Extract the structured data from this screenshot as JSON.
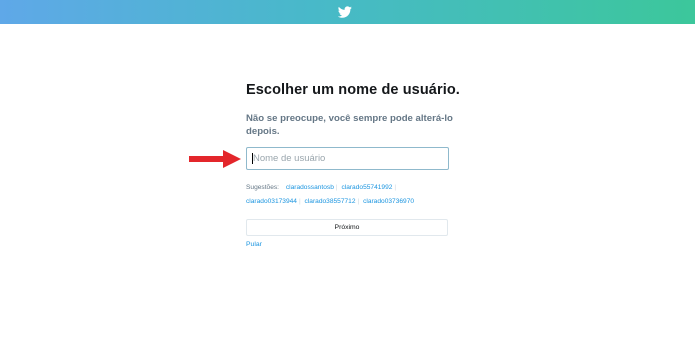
{
  "header": {
    "logo_icon": "twitter-bird-icon",
    "gradient_colors": [
      "#5fa8e8",
      "#3cc79b"
    ]
  },
  "main": {
    "title": "Escolher um nome de usuário.",
    "subtitle": "Não se preocupe, você sempre pode alterá-lo depois.",
    "username_input": {
      "placeholder": "Nome de usuário",
      "value": ""
    },
    "suggestions": {
      "label": "Sugestões:",
      "items": [
        "claradossantosb",
        "clarado55741992",
        "clarado03173944",
        "clarado38557712",
        "clarado03736970"
      ]
    },
    "next_button": "Próximo",
    "skip_link": "Pular"
  },
  "annotation": {
    "arrow_icon": "red-arrow-icon",
    "arrow_color": "#e3262b"
  },
  "colors": {
    "link": "#1b95e0",
    "title": "#14171a",
    "muted": "#657786"
  }
}
